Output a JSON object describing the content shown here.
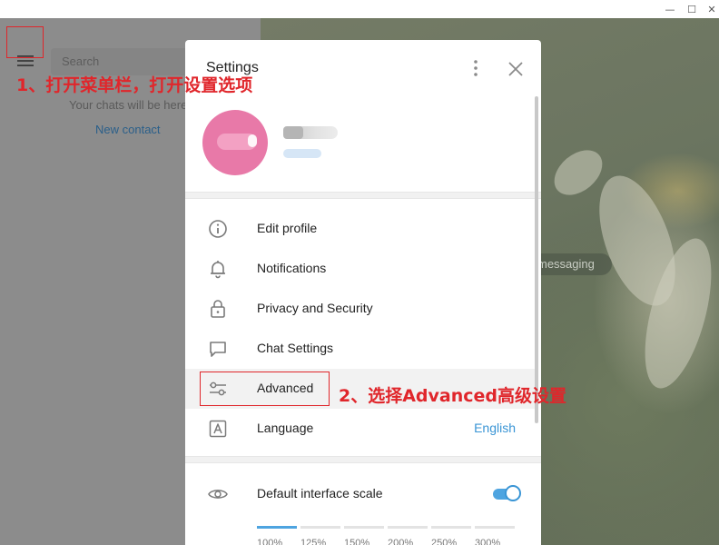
{
  "window": {
    "min_symbol": "—",
    "max_symbol": "☐",
    "close_symbol": "✕"
  },
  "sidebar": {
    "menu_icon": "hamburger-icon",
    "search_placeholder": "Search",
    "empty_text": "Your chats will be here",
    "new_contact_label": "New contact"
  },
  "chat": {
    "service_message": "messaging"
  },
  "settings": {
    "title": "Settings",
    "more_icon": "more-vertical-icon",
    "close_icon": "close-icon",
    "menu": [
      {
        "label": "Edit profile",
        "icon": "info-icon"
      },
      {
        "label": "Notifications",
        "icon": "bell-icon"
      },
      {
        "label": "Privacy and Security",
        "icon": "lock-icon"
      },
      {
        "label": "Chat Settings",
        "icon": "chat-bubble-icon"
      },
      {
        "label": "Advanced",
        "icon": "sliders-icon"
      },
      {
        "label": "Language",
        "icon": "language-icon",
        "value": "English"
      }
    ],
    "interface_scale": {
      "label": "Default interface scale",
      "icon": "eye-icon",
      "enabled": true,
      "options": [
        "100%",
        "125%",
        "150%",
        "200%",
        "250%",
        "300%"
      ]
    }
  },
  "annotations": {
    "step1": "1、打开菜单栏，打开设置选项",
    "step2": "2、选择Advanced高级设置"
  },
  "colors": {
    "accent": "#3a95d5",
    "annotation_red": "#e0262b",
    "avatar": "#e879a8"
  }
}
